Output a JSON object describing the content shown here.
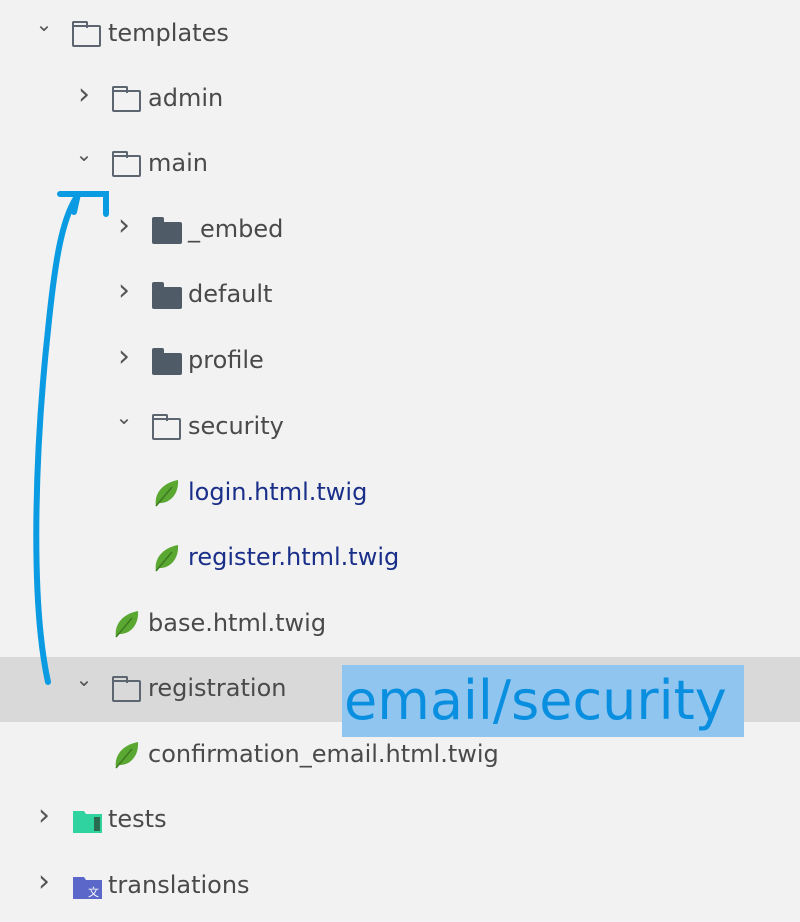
{
  "tree": [
    {
      "label": "templates",
      "level": 0,
      "state": "expanded",
      "icon": "folder-outline-icon"
    },
    {
      "label": "admin",
      "level": 1,
      "state": "collapsed",
      "icon": "folder-outline-icon"
    },
    {
      "label": "main",
      "level": 1,
      "state": "expanded",
      "icon": "folder-outline-icon"
    },
    {
      "label": "_embed",
      "level": 2,
      "state": "collapsed",
      "icon": "folder-solid-icon"
    },
    {
      "label": "default",
      "level": 2,
      "state": "collapsed",
      "icon": "folder-solid-icon"
    },
    {
      "label": "profile",
      "level": 2,
      "state": "collapsed",
      "icon": "folder-solid-icon"
    },
    {
      "label": "security",
      "level": 2,
      "state": "expanded",
      "icon": "folder-outline-icon"
    },
    {
      "label": "login.html.twig",
      "level": 3,
      "state": "file",
      "icon": "twig-leaf-icon"
    },
    {
      "label": "register.html.twig",
      "level": 3,
      "state": "file",
      "icon": "twig-leaf-icon"
    },
    {
      "label": "base.html.twig",
      "level": 2,
      "state": "file",
      "icon": "twig-leaf-icon"
    },
    {
      "label": "registration",
      "level": 1,
      "state": "expanded",
      "icon": "folder-outline-icon",
      "selected": true
    },
    {
      "label": "confirmation_email.html.twig",
      "level": 2,
      "state": "file",
      "icon": "twig-leaf-icon"
    },
    {
      "label": "tests",
      "level": 0,
      "state": "collapsed",
      "icon": "test-folder-icon"
    },
    {
      "label": "translations",
      "level": 0,
      "state": "collapsed",
      "icon": "translations-folder-icon"
    }
  ],
  "annotation": {
    "text": "email/security",
    "color": "#0a8fe0",
    "highlight": "#8fc5ee"
  },
  "colors": {
    "modified_file": "#1a2f8a",
    "selection": "#d9d9d9",
    "twig": "#5aa832",
    "tests": "#2fd3a0",
    "translations": "#5b68c9"
  }
}
